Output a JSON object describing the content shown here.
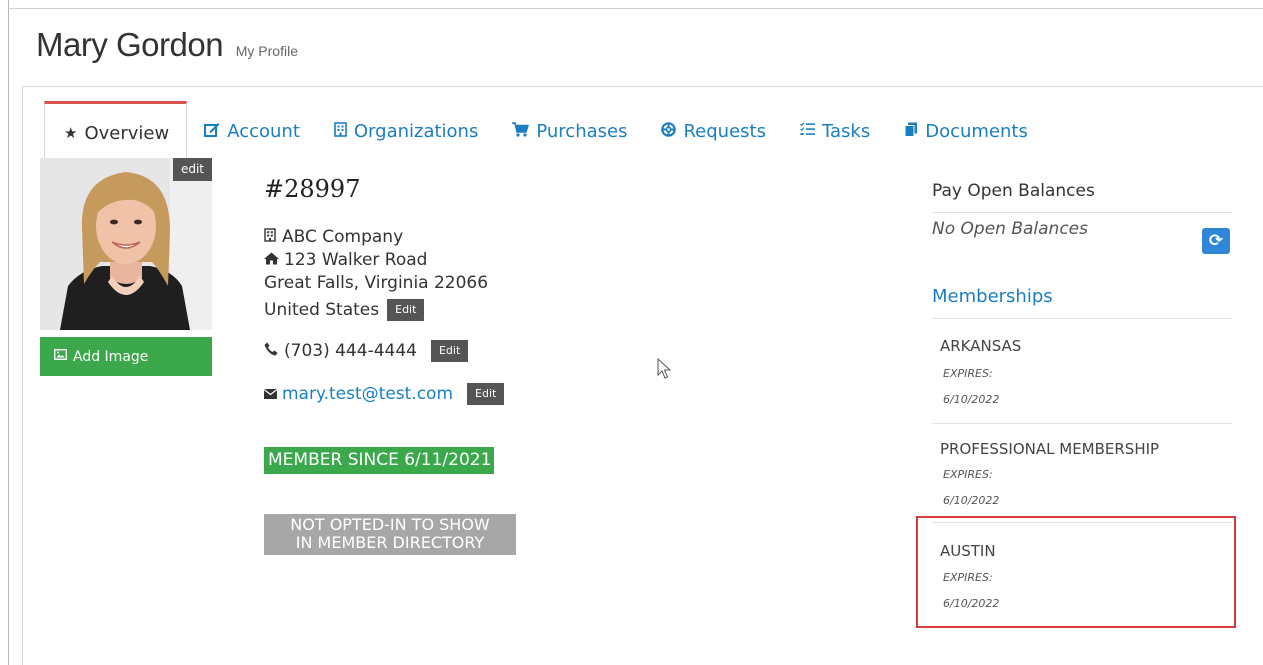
{
  "header": {
    "name": "Mary Gordon",
    "subtitle": "My Profile"
  },
  "tabs": [
    {
      "label": "Overview",
      "icon": "star-icon",
      "active": true
    },
    {
      "label": "Account",
      "icon": "edit-icon"
    },
    {
      "label": "Organizations",
      "icon": "building-icon"
    },
    {
      "label": "Purchases",
      "icon": "cart-icon"
    },
    {
      "label": "Requests",
      "icon": "lifebuoy-icon"
    },
    {
      "label": "Tasks",
      "icon": "tasks-icon"
    },
    {
      "label": "Documents",
      "icon": "documents-icon"
    }
  ],
  "photo": {
    "edit_label": "edit",
    "add_image_label": "Add Image"
  },
  "profile": {
    "id": "#28997",
    "company": "ABC Company",
    "street": "123 Walker Road",
    "city_line": "Great Falls, Virginia 22066",
    "country": "United States",
    "phone": "(703) 444-4444",
    "email": "mary.test@test.com",
    "edit_label": "Edit",
    "member_since": "MEMBER SINCE 6/11/2021",
    "directory_line1": "NOT OPTED-IN TO SHOW",
    "directory_line2": "IN MEMBER DIRECTORY"
  },
  "balances": {
    "title": "Pay Open Balances",
    "status": "No Open Balances"
  },
  "memberships": {
    "title": "Memberships",
    "items": [
      {
        "name": "ARKANSAS",
        "expires_label": "EXPIRES:",
        "expires": "6/10/2022"
      },
      {
        "name": "PROFESSIONAL MEMBERSHIP",
        "expires_label": "EXPIRES:",
        "expires": "6/10/2022"
      },
      {
        "name": "AUSTIN",
        "expires_label": "EXPIRES:",
        "expires": "6/10/2022"
      }
    ]
  },
  "colors": {
    "accent_link": "#1a7fc1",
    "success": "#3aa84b",
    "active_tab_border": "#d9534f",
    "highlight": "#d9383e",
    "button_dark": "#555555",
    "muted_badge": "#a7a7a7"
  }
}
